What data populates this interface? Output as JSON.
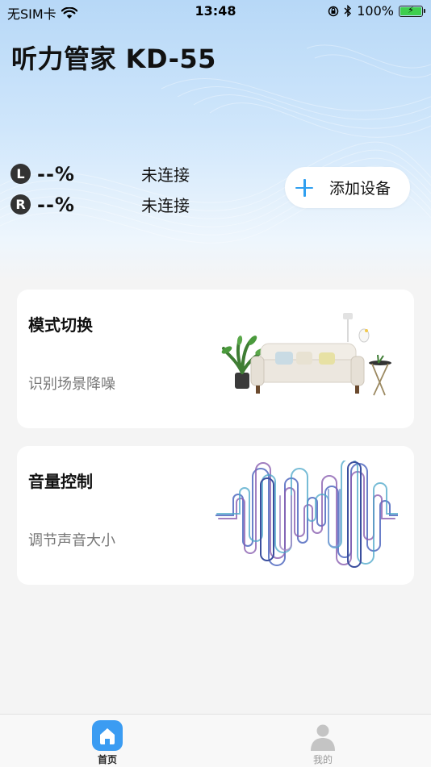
{
  "status_bar": {
    "carrier": "无SIM卡",
    "time": "13:48",
    "battery": "100%",
    "icons": [
      "wifi-icon",
      "orientation-lock-icon",
      "bluetooth-icon",
      "battery-charging-icon"
    ]
  },
  "header": {
    "title": "听力管家 KD-55"
  },
  "devices": {
    "left": {
      "badge": "L",
      "percent": "--%",
      "status": "未连接"
    },
    "right": {
      "badge": "R",
      "percent": "--%",
      "status": "未连接"
    }
  },
  "add_device": {
    "label": "添加设备",
    "icon": "plus-icon"
  },
  "cards": [
    {
      "title": "模式切换",
      "subtitle": "识别场景降噪",
      "art": "living-room-illustration"
    },
    {
      "title": "音量控制",
      "subtitle": "调节声音大小",
      "art": "sound-wave-illustration"
    }
  ],
  "tabbar": {
    "tabs": [
      {
        "label": "首页",
        "icon": "home-icon",
        "active": true
      },
      {
        "label": "我的",
        "icon": "user-icon",
        "active": false
      }
    ]
  },
  "colors": {
    "accent": "#2f9ff0",
    "tab_active": "#3b9cf2",
    "tab_inactive": "#c4c4c4"
  }
}
